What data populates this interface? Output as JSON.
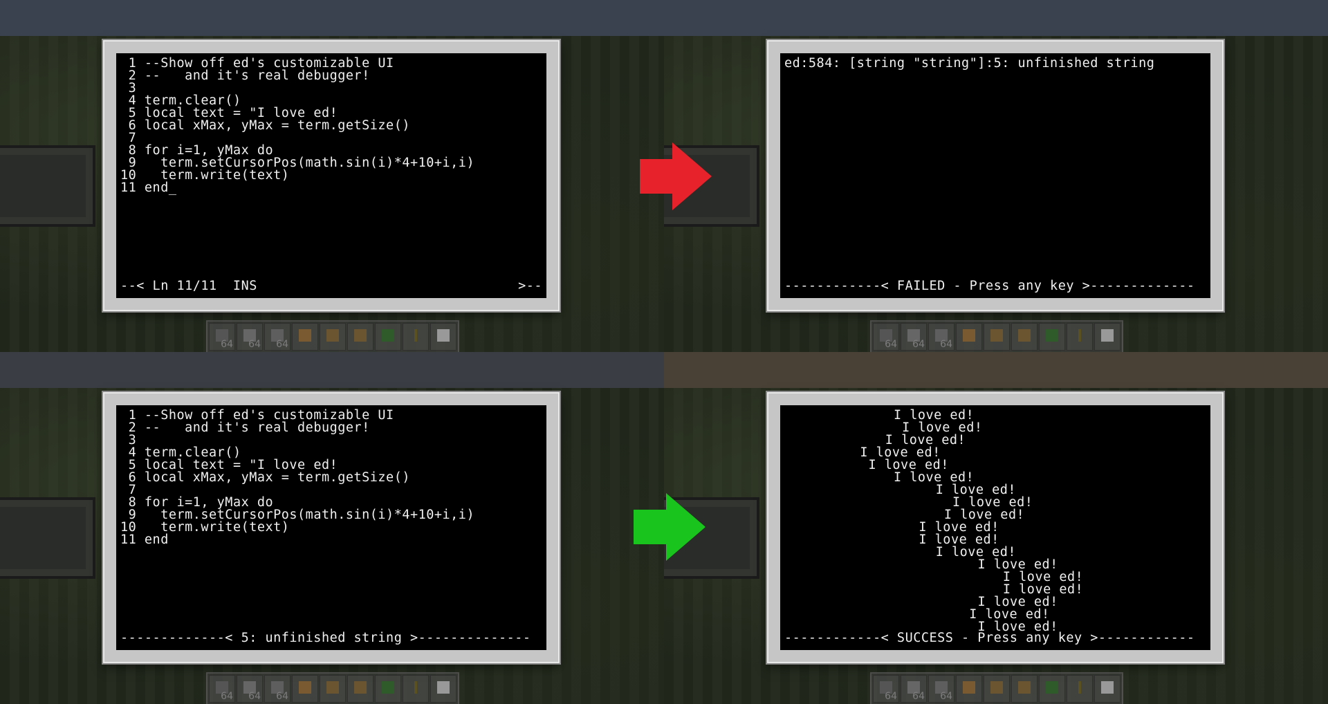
{
  "editor": {
    "lines": [
      {
        "num": " 1",
        "code": "--Show off ed's customizable UI"
      },
      {
        "num": " 2",
        "code": "--   and it's real debugger!"
      },
      {
        "num": " 3",
        "code": ""
      },
      {
        "num": " 4",
        "code": "term.clear()"
      },
      {
        "num": " 5",
        "code": "local text = \"I love ed!"
      },
      {
        "num": " 6",
        "code": "local xMax, yMax = term.getSize()"
      },
      {
        "num": " 7",
        "code": ""
      },
      {
        "num": " 8",
        "code": "for i=1, yMax do"
      },
      {
        "num": " 9",
        "code": "  term.setCursorPos(math.sin(i)*4+10+i,i)"
      },
      {
        "num": "10",
        "code": "  term.write(text)"
      },
      {
        "num": "11",
        "code": "end_"
      }
    ],
    "status_left": "--< Ln 11/11  INS",
    "status_right": ">--"
  },
  "failed": {
    "error_line": "ed:584: [string \"string\"]:5: unfinished string",
    "status": "------------< FAILED - Press any key >-------------"
  },
  "debug": {
    "last_line_code": "end",
    "status": "-------------< 5: unfinished string >--------------"
  },
  "success": {
    "output_text": "I love ed!",
    "status": "------------< SUCCESS - Press any key >------------"
  },
  "hotbar": {
    "counts": [
      "64",
      "64",
      "64"
    ]
  },
  "arrows": {
    "fail_color": "#e8222a",
    "success_color": "#19c41c"
  }
}
